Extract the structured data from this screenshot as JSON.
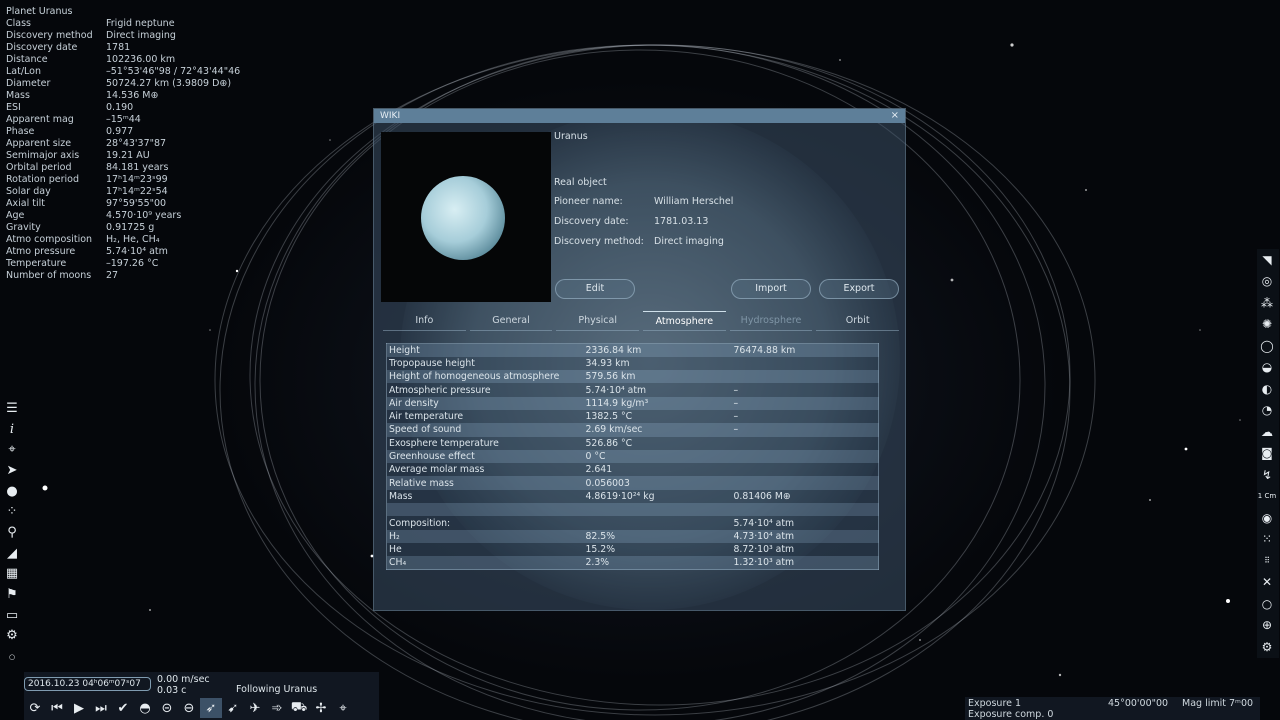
{
  "info": {
    "title": "Planet  Uranus",
    "rows": [
      {
        "k": "Class",
        "v": "Frigid neptune"
      },
      {
        "k": "Discovery method",
        "v": "Direct imaging"
      },
      {
        "k": "Discovery date",
        "v": "1781"
      },
      {
        "k": "Distance",
        "v": "102236.00 km"
      },
      {
        "k": "Lat/Lon",
        "v": "–51°53'46\"98 / 72°43'44\"46"
      },
      {
        "k": "Diameter",
        "v": "50724.27 km (3.9809 D⊕)"
      },
      {
        "k": "Mass",
        "v": "14.536 M⊕"
      },
      {
        "k": "ESI",
        "v": "0.190"
      },
      {
        "k": "Apparent mag",
        "v": "–15ᵐ44"
      },
      {
        "k": "Phase",
        "v": "0.977"
      },
      {
        "k": "Apparent size",
        "v": "28°43'37\"87"
      },
      {
        "k": "Semimajor axis",
        "v": "19.21 AU"
      },
      {
        "k": "Orbital period",
        "v": "84.181 years"
      },
      {
        "k": "Rotation period",
        "v": "17ʰ14ᵐ23ˢ99"
      },
      {
        "k": "Solar day",
        "v": "17ʰ14ᵐ22ˢ54"
      },
      {
        "k": "Axial tilt",
        "v": "97°59'55\"00"
      },
      {
        "k": "Age",
        "v": "4.570·10⁹ years"
      },
      {
        "k": "Gravity",
        "v": "0.91725 g"
      },
      {
        "k": "Atmo composition",
        "v": "H₂, He, CH₄"
      },
      {
        "k": "Atmo pressure",
        "v": "5.74·10⁴ atm"
      },
      {
        "k": "Temperature",
        "v": "–197.26 °C"
      },
      {
        "k": "Number of moons",
        "v": "27"
      }
    ]
  },
  "wiki": {
    "title": "WIKI",
    "close": "×",
    "name": "Uranus",
    "real": "Real object",
    "fields": [
      {
        "label": "Pioneer name:",
        "value": "William Herschel"
      },
      {
        "label": "Discovery date:",
        "value": "1781.03.13"
      },
      {
        "label": "Discovery method:",
        "value": "Direct imaging"
      }
    ],
    "buttons": {
      "edit": "Edit",
      "import": "Import",
      "export": "Export"
    },
    "tabs": [
      "Info",
      "General",
      "Physical",
      "Atmosphere",
      "Hydrosphere",
      "Orbit"
    ],
    "table": [
      [
        "Height",
        "2336.84 km",
        "76474.88 km"
      ],
      [
        "Tropopause height",
        "34.93 km",
        ""
      ],
      [
        "Height of homogeneous atmosphere",
        "579.56 km",
        ""
      ],
      [
        "Atmospheric pressure",
        "5.74·10⁴ atm",
        "–"
      ],
      [
        "Air density",
        "1114.9 kg/m³",
        "–"
      ],
      [
        "Air temperature",
        "1382.5 °C",
        "–"
      ],
      [
        "Speed of sound",
        "2.69 km/sec",
        "–"
      ],
      [
        "Exosphere temperature",
        "526.86 °C",
        ""
      ],
      [
        "Greenhouse effect",
        "0 °C",
        ""
      ],
      [
        "Average molar mass",
        "2.641",
        ""
      ],
      [
        "Relative mass",
        "0.056003",
        ""
      ],
      [
        "Mass",
        "4.8619·10²⁴ kg",
        "0.81406 M⊕"
      ],
      [
        "",
        "",
        ""
      ],
      [
        "Composition:",
        "",
        "5.74·10⁴ atm"
      ],
      [
        "H₂",
        "82.5%",
        "4.73·10⁴ atm"
      ],
      [
        "He",
        "15.2%",
        "8.72·10³ atm"
      ],
      [
        "CH₄",
        "2.3%",
        "1.32·10³ atm"
      ]
    ]
  },
  "left_tools": [
    "menu-icon",
    "info-icon",
    "satellite-icon",
    "rocket-icon",
    "binoculars-icon",
    "constellation-icon",
    "search-icon",
    "ship-icon",
    "calendar-icon",
    "flag-icon",
    "monitor-icon",
    "gear-icon"
  ],
  "right_tools": [
    "galaxy-icon",
    "nebula-icon",
    "cluster-icon",
    "star-icon",
    "ring-icon",
    "planet-icon",
    "comet-icon",
    "asteroid-icon",
    "cloud-icon",
    "ocean-icon",
    "lightning-icon",
    "scale-icon",
    "eye-icon",
    "dots-icon",
    "rs-icon",
    "cross-icon",
    "circle-icon",
    "globe-icon",
    "gear-icon"
  ],
  "bottom": {
    "time": "2016.10.23  04ʰ06ᵐ07ˢ07",
    "speed1": "0.00 m/sec",
    "speed2": "0.03 c",
    "following": "Following Uranus",
    "scale_label": "1 Cm"
  },
  "exposure": {
    "exposure": "Exposure 1",
    "comp": "Exposure comp. 0",
    "fov": "45°00'00\"00",
    "mag": "Mag limit 7ᵐ00"
  }
}
